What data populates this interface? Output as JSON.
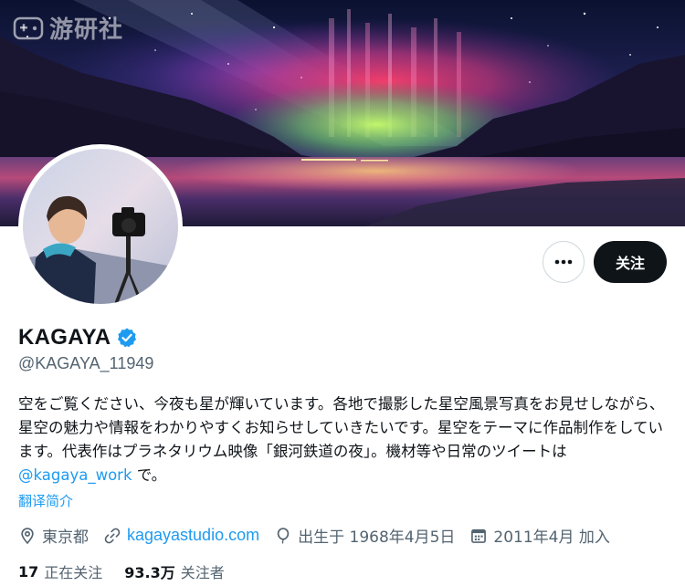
{
  "watermark": {
    "text": "游研社"
  },
  "profile": {
    "display_name": "KAGAYA",
    "handle": "@KAGAYA_11949",
    "follow_label": "关注",
    "more_label": "•••"
  },
  "bio": {
    "text_before_mention": "空をご覧ください、今夜も星が輝いています。各地で撮影した星空風景写真をお見せしながら、星空の魅力や情報をわかりやすくお知らせしていきたいです。星空をテーマに作品制作をしています。代表作はプラネタリウム映像「銀河鉄道の夜」。機材等や日常のツイートは",
    "mention": "@kagaya_work",
    "text_after_mention": " で。",
    "translate_label": "翻译简介"
  },
  "meta": {
    "location": "東京都",
    "website": "kagayastudio.com",
    "birthday": "出生于 1968年4月5日",
    "joined": "2011年4月 加入"
  },
  "stats": {
    "following_count": "17",
    "following_label": "正在关注",
    "followers_count": "93.3万",
    "followers_label": "关注者"
  },
  "colors": {
    "accent": "#1d9bf0",
    "text_primary": "#0f1419",
    "text_secondary": "#536471",
    "border": "#cfd9de",
    "verified": "#1d9bf0"
  },
  "icons": [
    "verified-badge-icon",
    "location-pin-icon",
    "link-icon",
    "balloon-icon",
    "calendar-icon",
    "more-dots-icon",
    "gamepad-logo-icon"
  ]
}
